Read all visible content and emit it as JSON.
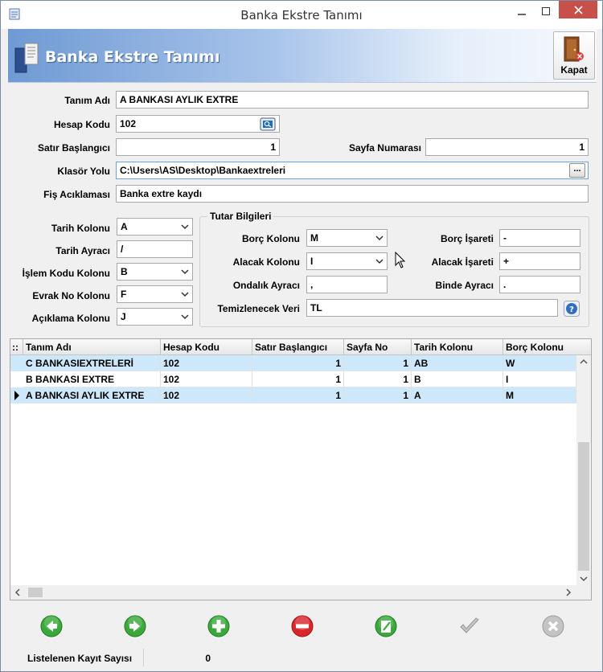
{
  "window": {
    "title": "Banka Ekstre Tanımı"
  },
  "header": {
    "title": "Banka Ekstre Tanımı",
    "close_label": "Kapat"
  },
  "form": {
    "tanim_adi": {
      "label": "Tanım Adı",
      "value": "A BANKASI AYLIK EXTRE"
    },
    "hesap_kodu": {
      "label": "Hesap Kodu",
      "value": "102"
    },
    "satir_baslangici": {
      "label": "Satır Başlangıcı",
      "value": "1"
    },
    "sayfa_numarasi": {
      "label": "Sayfa Numarası",
      "value": "1"
    },
    "klasor_yolu": {
      "label": "Klasör Yolu",
      "value": "C:\\Users\\AS\\Desktop\\Bankaextreleri",
      "browse": "..."
    },
    "fis_aciklamasi": {
      "label": "Fiş Acıklaması",
      "value": "Banka extre kaydı"
    },
    "tarih_kolonu": {
      "label": "Tarih Kolonu",
      "value": "A"
    },
    "tarih_ayraci": {
      "label": "Tarih Ayracı",
      "value": "/"
    },
    "islem_kodu_kolonu": {
      "label": "İşlem Kodu Kolonu",
      "value": "B"
    },
    "evrak_no_kolonu": {
      "label": "Evrak No Kolonu",
      "value": "F"
    },
    "aciklama_kolonu": {
      "label": "Açıklama Kolonu",
      "value": "J"
    }
  },
  "tutar": {
    "title": "Tutar Bilgileri",
    "borc_kolonu": {
      "label": "Borç Kolonu",
      "value": "M"
    },
    "alacak_kolonu": {
      "label": "Alacak Kolonu",
      "value": "I"
    },
    "ondalik_ayraci": {
      "label": "Ondalık Ayracı",
      "value": ","
    },
    "borc_isareti": {
      "label": "Borç İşareti",
      "value": "-"
    },
    "alacak_isareti": {
      "label": "Alacak İşareti",
      "value": "+"
    },
    "binde_ayraci": {
      "label": "Binde Ayracı",
      "value": "."
    },
    "temizlenecek_veri": {
      "label": "Temizlenecek Veri",
      "value": "TL"
    }
  },
  "grid": {
    "headers": [
      "Tanım Adı",
      "Hesap Kodu",
      "Satır Başlangıcı",
      "Sayfa No",
      "Tarih Kolonu",
      "Borç Kolonu"
    ],
    "rows": [
      [
        "C BANKASIEXTRELERİ",
        "102",
        "1",
        "1",
        "AB",
        "W"
      ],
      [
        "B BANKASI EXTRE",
        "102",
        "1",
        "1",
        "B",
        "I"
      ],
      [
        "A BANKASI AYLIK EXTRE",
        "102",
        "1",
        "1",
        "A",
        "M"
      ]
    ],
    "corner_glyph": "::"
  },
  "actions": [
    {
      "name": "previous-button",
      "icon": "arrow-left-icon",
      "color": "#3aa83a"
    },
    {
      "name": "next-button",
      "icon": "arrow-right-icon",
      "color": "#3aa83a"
    },
    {
      "name": "add-button",
      "icon": "plus-icon",
      "color": "#3aa83a"
    },
    {
      "name": "delete-button",
      "icon": "minus-icon",
      "color": "#d8262c"
    },
    {
      "name": "edit-button",
      "icon": "edit-icon",
      "color": "#3aa83a"
    },
    {
      "name": "confirm-button",
      "icon": "check-icon",
      "color": "#b8b8b8"
    },
    {
      "name": "cancel-button",
      "icon": "x-icon",
      "color": "#b8b8b8"
    }
  ],
  "status": {
    "label": "Listelenen Kayıt Sayısı",
    "value": "0"
  }
}
